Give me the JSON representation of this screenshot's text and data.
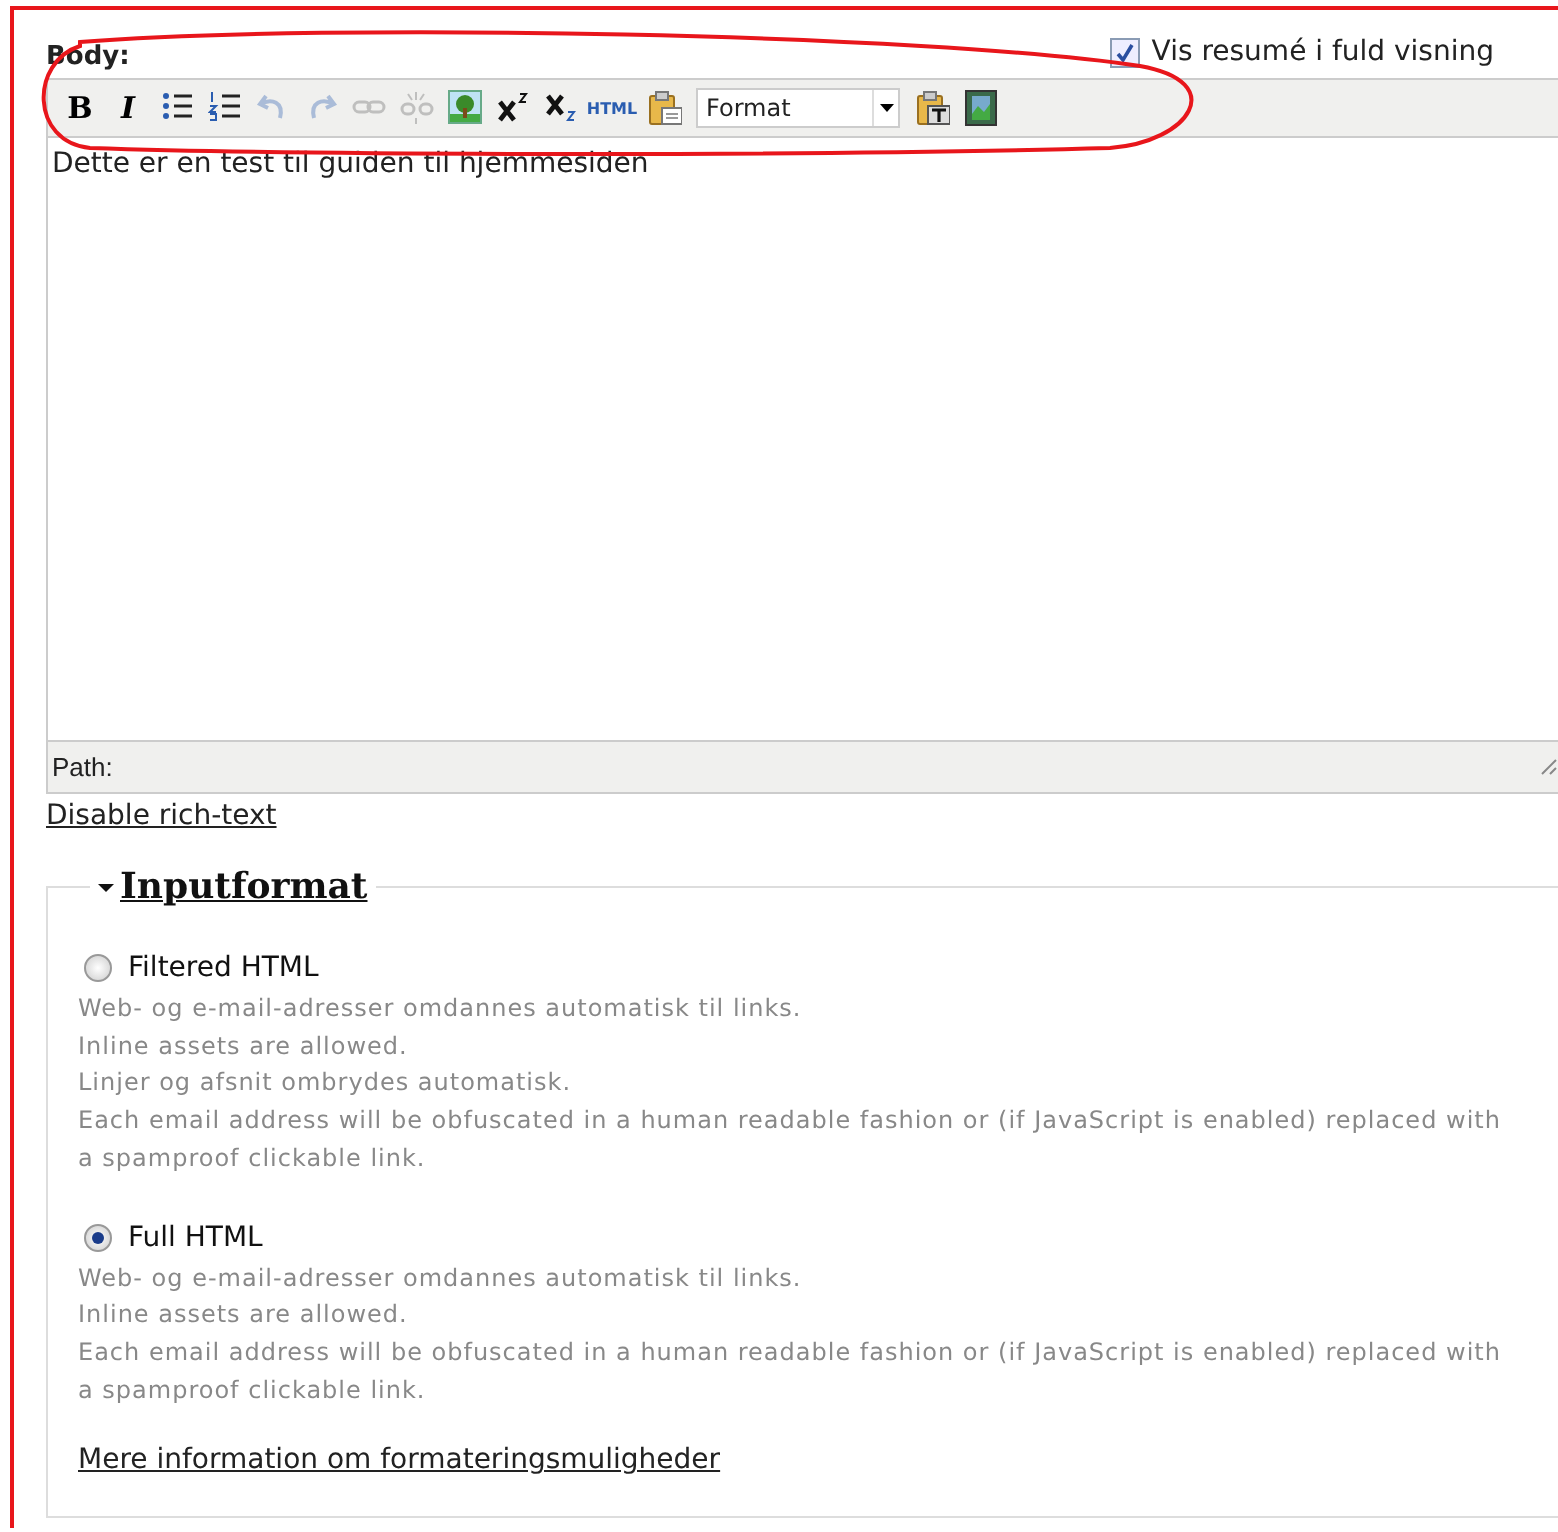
{
  "body_label": "Body:",
  "summary_checkbox": {
    "label": "Vis resumé i fuld visning",
    "checked": true
  },
  "toolbar": [
    {
      "kind": "bold",
      "label": "B",
      "disabled": false
    },
    {
      "kind": "italic",
      "label": "I",
      "disabled": false
    },
    {
      "kind": "bullets",
      "disabled": false
    },
    {
      "kind": "numbers",
      "disabled": false
    },
    {
      "kind": "undo",
      "disabled": true
    },
    {
      "kind": "redo",
      "disabled": true
    },
    {
      "kind": "link",
      "disabled": true
    },
    {
      "kind": "unlink",
      "disabled": true
    },
    {
      "kind": "image",
      "disabled": false
    },
    {
      "kind": "sup",
      "disabled": false
    },
    {
      "kind": "sub",
      "disabled": false
    },
    {
      "kind": "html",
      "label": "HTML",
      "disabled": false
    },
    {
      "kind": "paste",
      "disabled": false
    },
    {
      "kind": "select",
      "value": "Format"
    },
    {
      "kind": "pastetext",
      "disabled": false
    },
    {
      "kind": "media",
      "disabled": false
    }
  ],
  "editor_text": "Dette er en test til guiden til hjemmesiden",
  "path_label": "Path:",
  "disable_link": "Disable rich-text",
  "input_format": {
    "legend": "Inputformat",
    "expanded": true,
    "options": [
      {
        "label": "Filtered HTML",
        "selected": false,
        "tips": [
          "Web- og e-mail-adresser omdannes automatisk til links.",
          "Inline assets are allowed.",
          "Linjer og afsnit ombrydes automatisk.",
          "Each email address will be obfuscated in a human readable fashion or (if JavaScript is enabled) replaced with a spamproof clickable link."
        ]
      },
      {
        "label": "Full HTML",
        "selected": true,
        "tips": [
          "Web- og e-mail-adresser omdannes automatisk til links.",
          "Inline assets are allowed.",
          "Each email address will be obfuscated in a human readable fashion or (if JavaScript is enabled) replaced with a spamproof clickable link."
        ]
      }
    ],
    "more_link": "Mere information om formateringsmuligheder"
  }
}
